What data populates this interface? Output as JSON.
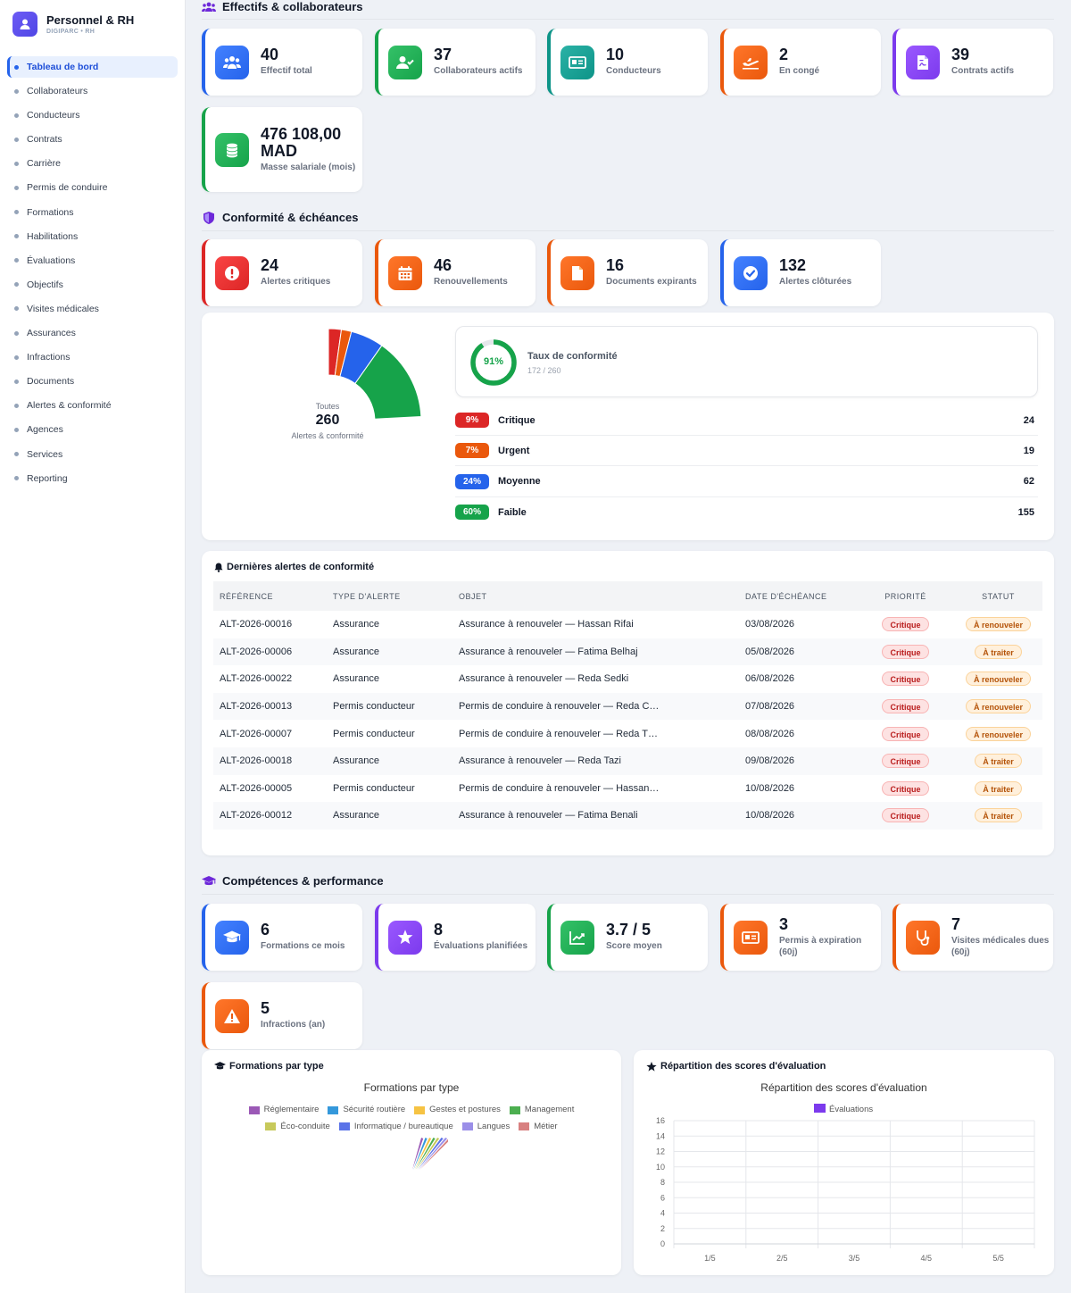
{
  "sidebar": {
    "title": "Personnel & RH",
    "subtitle": "DIGIPARC • RH",
    "items": [
      {
        "label": "Tableau de bord",
        "active": true
      },
      {
        "label": "Collaborateurs"
      },
      {
        "label": "Conducteurs"
      },
      {
        "label": "Contrats"
      },
      {
        "label": "Carrière"
      },
      {
        "label": "Permis de conduire"
      },
      {
        "label": "Formations"
      },
      {
        "label": "Habilitations"
      },
      {
        "label": "Évaluations"
      },
      {
        "label": "Objectifs"
      },
      {
        "label": "Visites médicales"
      },
      {
        "label": "Assurances"
      },
      {
        "label": "Infractions"
      },
      {
        "label": "Documents"
      },
      {
        "label": "Alertes & conformité"
      },
      {
        "label": "Agences"
      },
      {
        "label": "Services"
      },
      {
        "label": "Reporting"
      }
    ]
  },
  "sections": {
    "effectifs": "Effectifs & collaborateurs",
    "conformite": "Conformité & échéances",
    "competences": "Compétences & performance"
  },
  "kpis_effectifs": [
    {
      "value": "40",
      "label": "Effectif total",
      "color": "#2563eb",
      "icon": "users-icon"
    },
    {
      "value": "37",
      "label": "Collaborateurs actifs",
      "color": "#16a34a",
      "icon": "user-check-icon"
    },
    {
      "value": "10",
      "label": "Conducteurs",
      "color": "#0d9488",
      "icon": "id-card-icon"
    },
    {
      "value": "2",
      "label": "En congé",
      "color": "#ea580c",
      "icon": "plane-icon"
    },
    {
      "value": "39",
      "label": "Contrats actifs",
      "color": "#7c3aed",
      "icon": "contract-icon"
    },
    {
      "value": "476 108,00 MAD",
      "label": "Masse salariale (mois)",
      "color": "#16a34a",
      "icon": "coins-icon"
    }
  ],
  "kpis_conformite": [
    {
      "value": "24",
      "label": "Alertes critiques",
      "color": "#dc2626",
      "icon": "alert-circle-icon"
    },
    {
      "value": "46",
      "label": "Renouvellements",
      "color": "#ea580c",
      "icon": "calendar-icon"
    },
    {
      "value": "16",
      "label": "Documents expirants",
      "color": "#ea580c",
      "icon": "file-icon"
    },
    {
      "value": "132",
      "label": "Alertes clôturées",
      "color": "#2563eb",
      "icon": "check-circle-icon"
    }
  ],
  "compliance": {
    "donut_caption": "Toutes",
    "donut_total": "260",
    "donut_sub": "Alertes & conformité",
    "rate_value": "91%",
    "rate_label": "Taux de conformité",
    "rate_detail": "172 / 260",
    "rate_fraction": 0.91,
    "priorities": [
      {
        "pct": "9%",
        "name": "Critique",
        "count": "24",
        "value": 24,
        "color": "#dc2626"
      },
      {
        "pct": "7%",
        "name": "Urgent",
        "count": "19",
        "value": 19,
        "color": "#ea580c"
      },
      {
        "pct": "24%",
        "name": "Moyenne",
        "count": "62",
        "value": 62,
        "color": "#2563eb"
      },
      {
        "pct": "60%",
        "name": "Faible",
        "count": "155",
        "value": 155,
        "color": "#16a34a"
      }
    ]
  },
  "alerts_table": {
    "title": "Dernières alertes de conformité",
    "headers": [
      "RÉFÉRENCE",
      "TYPE D'ALERTE",
      "OBJET",
      "DATE D'ÉCHÉANCE",
      "PRIORITÉ",
      "STATUT"
    ],
    "rows": [
      {
        "ref": "ALT-2026-00016",
        "type": "Assurance",
        "object": "Assurance à renouveler — Hassan Rifai",
        "date": "03/08/2026",
        "priority": "Critique",
        "status": "À renouveler"
      },
      {
        "ref": "ALT-2026-00006",
        "type": "Assurance",
        "object": "Assurance à renouveler — Fatima Belhaj",
        "date": "05/08/2026",
        "priority": "Critique",
        "status": "À traiter"
      },
      {
        "ref": "ALT-2026-00022",
        "type": "Assurance",
        "object": "Assurance à renouveler — Reda Sedki",
        "date": "06/08/2026",
        "priority": "Critique",
        "status": "À renouveler"
      },
      {
        "ref": "ALT-2026-00013",
        "type": "Permis conducteur",
        "object": "Permis de conduire à renouveler — Reda C…",
        "date": "07/08/2026",
        "priority": "Critique",
        "status": "À renouveler"
      },
      {
        "ref": "ALT-2026-00007",
        "type": "Permis conducteur",
        "object": "Permis de conduire à renouveler — Reda T…",
        "date": "08/08/2026",
        "priority": "Critique",
        "status": "À renouveler"
      },
      {
        "ref": "ALT-2026-00018",
        "type": "Assurance",
        "object": "Assurance à renouveler — Reda Tazi",
        "date": "09/08/2026",
        "priority": "Critique",
        "status": "À traiter"
      },
      {
        "ref": "ALT-2026-00005",
        "type": "Permis conducteur",
        "object": "Permis de conduire à renouveler — Hassan…",
        "date": "10/08/2026",
        "priority": "Critique",
        "status": "À traiter"
      },
      {
        "ref": "ALT-2026-00012",
        "type": "Assurance",
        "object": "Assurance à renouveler — Fatima Benali",
        "date": "10/08/2026",
        "priority": "Critique",
        "status": "À traiter"
      }
    ]
  },
  "kpis_competences": [
    {
      "value": "6",
      "label": "Formations ce mois",
      "color": "#2563eb",
      "icon": "graduation-cap-icon"
    },
    {
      "value": "8",
      "label": "Évaluations planifiées",
      "color": "#7c3aed",
      "icon": "star-icon"
    },
    {
      "value": "3.7 / 5",
      "label": "Score moyen",
      "color": "#16a34a",
      "icon": "chart-line-icon"
    },
    {
      "value": "3",
      "label": "Permis à expiration (60j)",
      "color": "#ea580c",
      "icon": "id-card-icon"
    },
    {
      "value": "7",
      "label": "Visites médicales dues (60j)",
      "color": "#ea580c",
      "icon": "stethoscope-icon"
    },
    {
      "value": "5",
      "label": "Infractions (an)",
      "color": "#ea580c",
      "icon": "warning-icon"
    }
  ],
  "chart_formations": {
    "card_title": "Formations par type",
    "chart_data": {
      "type": "pie",
      "title": "Formations par type",
      "categories": [
        "Réglementaire",
        "Sécurité routière",
        "Gestes et postures",
        "Management",
        "Éco-conduite",
        "Informatique / bureautique",
        "Langues",
        "Métier"
      ],
      "colors": [
        "#9b59b6",
        "#3498db",
        "#f6c343",
        "#4caf50",
        "#c7c95b",
        "#5b73e8",
        "#9b8fe8",
        "#d88080"
      ],
      "values": [
        1,
        1,
        1,
        1,
        1,
        1,
        1,
        1
      ]
    }
  },
  "chart_scores": {
    "card_title": "Répartition des scores d'évaluation",
    "chart_data": {
      "type": "bar",
      "title": "Répartition des scores d'évaluation",
      "categories": [
        "1/5",
        "2/5",
        "3/5",
        "4/5",
        "5/5"
      ],
      "series": [
        {
          "name": "Évaluations",
          "values": [
            0,
            0,
            0,
            0,
            0
          ],
          "color": "#7c3aed"
        }
      ],
      "ylim": [
        0,
        16
      ],
      "yticks": [
        0,
        2,
        4,
        6,
        8,
        10,
        12,
        14,
        16
      ],
      "grid": true,
      "legend": "top"
    }
  }
}
